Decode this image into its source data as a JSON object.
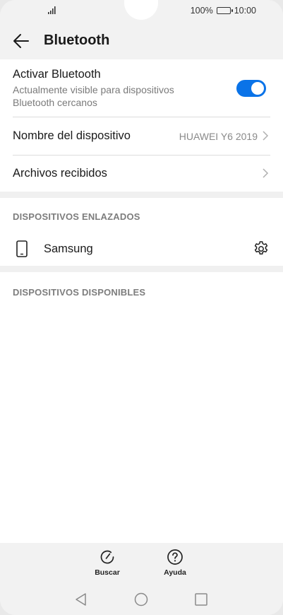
{
  "status_bar": {
    "battery_text": "100%",
    "time": "10:00",
    "battery_level": 1.0,
    "signal_icon": "signal-icon",
    "battery_icon": "battery-icon"
  },
  "header": {
    "title": "Bluetooth",
    "back_icon": "back-arrow-icon"
  },
  "bluetooth_toggle": {
    "title": "Activar Bluetooth",
    "subtitle": "Actualmente visible para dispositivos Bluetooth cercanos",
    "enabled": true
  },
  "device_name": {
    "label": "Nombre del dispositivo",
    "value": "HUAWEI Y6 2019"
  },
  "received_files": {
    "label": "Archivos recibidos"
  },
  "paired": {
    "header": "DISPOSITIVOS ENLAZADOS",
    "devices": [
      {
        "name": "Samsung",
        "icon": "phone-icon",
        "settings_icon": "gear-icon"
      }
    ]
  },
  "available": {
    "header": "DISPOSITIVOS DISPONIBLES"
  },
  "bottom_actions": [
    {
      "label": "Buscar",
      "icon": "refresh-icon"
    },
    {
      "label": "Ayuda",
      "icon": "help-icon"
    }
  ],
  "nav": {
    "back_icon": "nav-back-icon",
    "home_icon": "nav-home-icon",
    "recents_icon": "nav-recents-icon"
  },
  "colors": {
    "accent": "#0a73e8",
    "background": "#f2f2f2",
    "surface": "#ffffff",
    "secondary_text": "#7a7a7a"
  }
}
